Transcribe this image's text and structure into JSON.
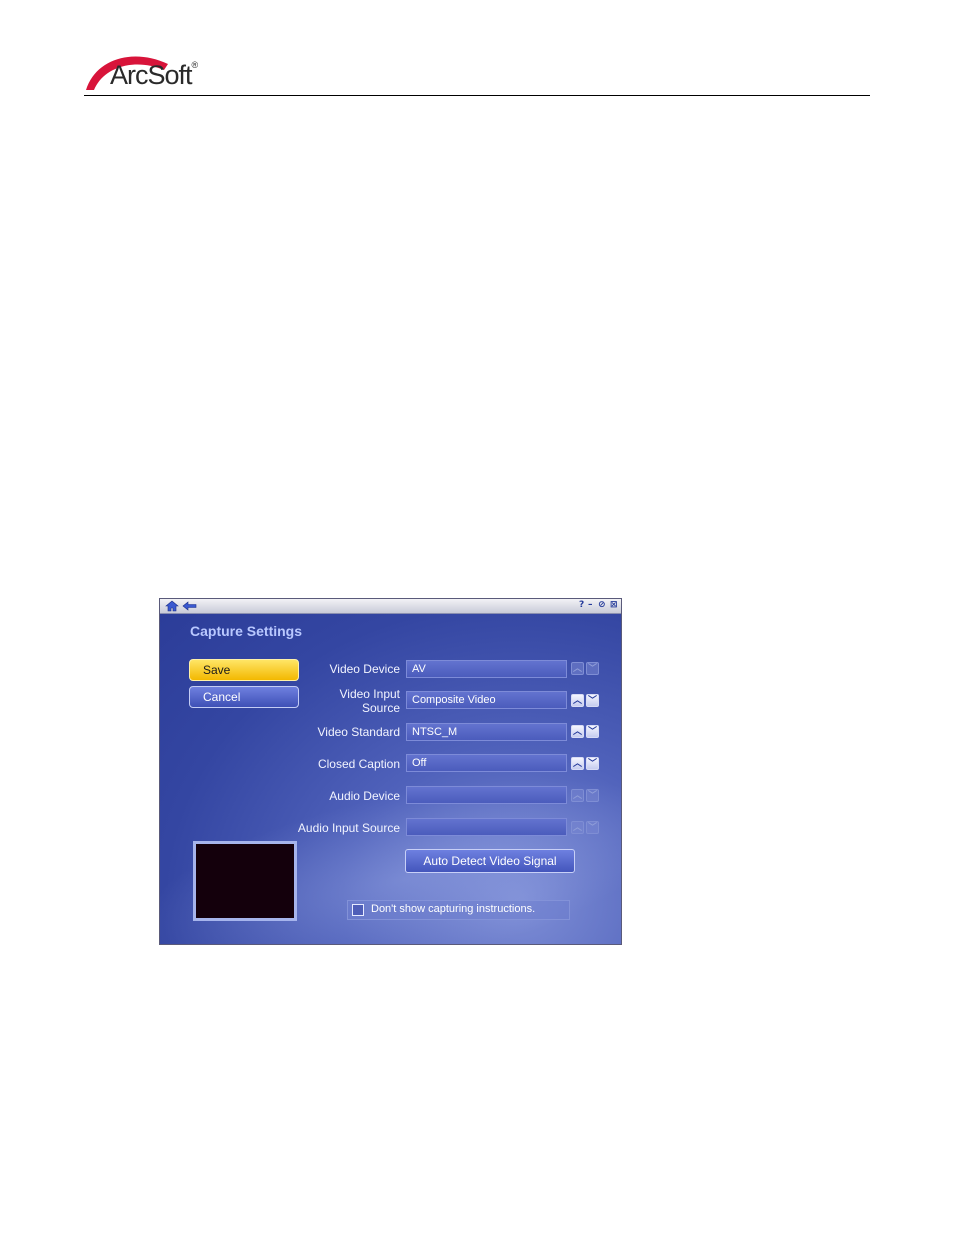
{
  "header": {
    "brand": "ArcSoft",
    "registered": "®"
  },
  "window": {
    "title": "Capture Settings",
    "titlebar": {
      "help": "?",
      "minimize": "–",
      "restore": "⊘",
      "close": "⊠"
    }
  },
  "buttons": {
    "save": "Save",
    "cancel": "Cancel"
  },
  "fields": [
    {
      "label": "Video Device",
      "value": "AV",
      "arrows_enabled": false
    },
    {
      "label_line1": "Video Input",
      "label_line2": "Source",
      "value": "Composite Video",
      "arrows_enabled": true
    },
    {
      "label": "Video Standard",
      "value": "NTSC_M",
      "arrows_enabled": true
    },
    {
      "label": "Closed Caption",
      "value": "Off",
      "arrows_enabled": true
    },
    {
      "label": "Audio Device",
      "value": "",
      "arrows_enabled": false
    },
    {
      "label": "Audio Input Source",
      "value": "",
      "arrows_enabled": false
    }
  ],
  "detect_button": "Auto Detect Video Signal",
  "checkbox": {
    "label": "Don't show capturing instructions.",
    "checked": false
  },
  "colors": {
    "accent": "#3446a2",
    "save": "#f3b800",
    "brand_red": "#d8143a"
  }
}
